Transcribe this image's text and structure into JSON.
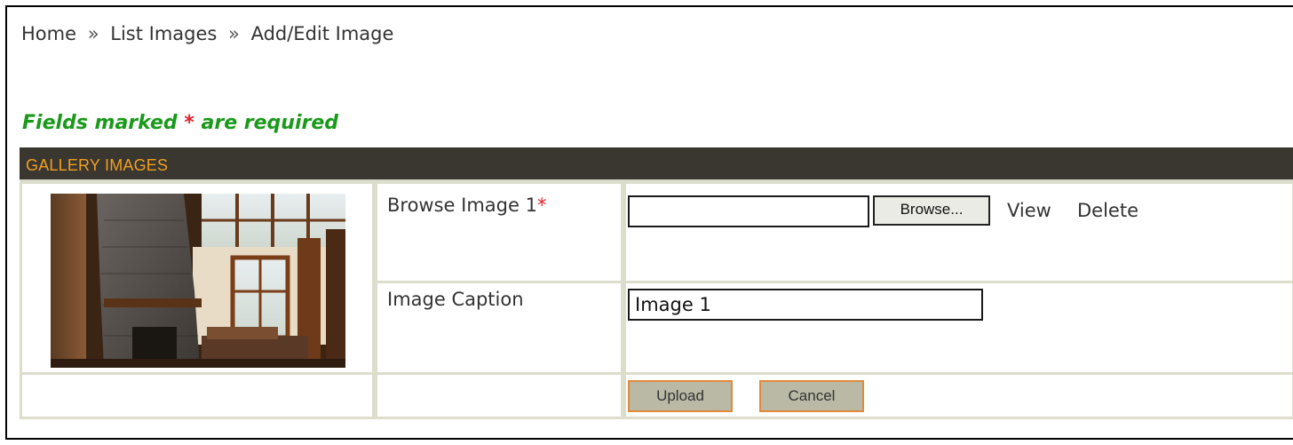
{
  "breadcrumb": {
    "home": "Home",
    "separator_1": "»",
    "list_images": "List Images",
    "separator_2": "»",
    "current": "Add/Edit Image"
  },
  "notice": {
    "prefix": "Fields marked ",
    "star": "*",
    "suffix": " are required"
  },
  "section": {
    "title": "GALLERY IMAGES"
  },
  "form": {
    "browse_label": "Browse Image 1",
    "browse_required_star": "*",
    "file_value": "",
    "browse_button": "Browse...",
    "view_link": "View",
    "delete_link": "Delete",
    "caption_label": "Image Caption",
    "caption_value": "Image 1"
  },
  "actions": {
    "upload": "Upload",
    "cancel": "Cancel"
  },
  "colors": {
    "header_bar": "#3a3630",
    "section_title": "#f0a020",
    "required_note": "#1a9a1a",
    "required_star": "#e0202a",
    "action_button_bg": "#b9b9a6",
    "action_button_border": "#e08a3a"
  }
}
